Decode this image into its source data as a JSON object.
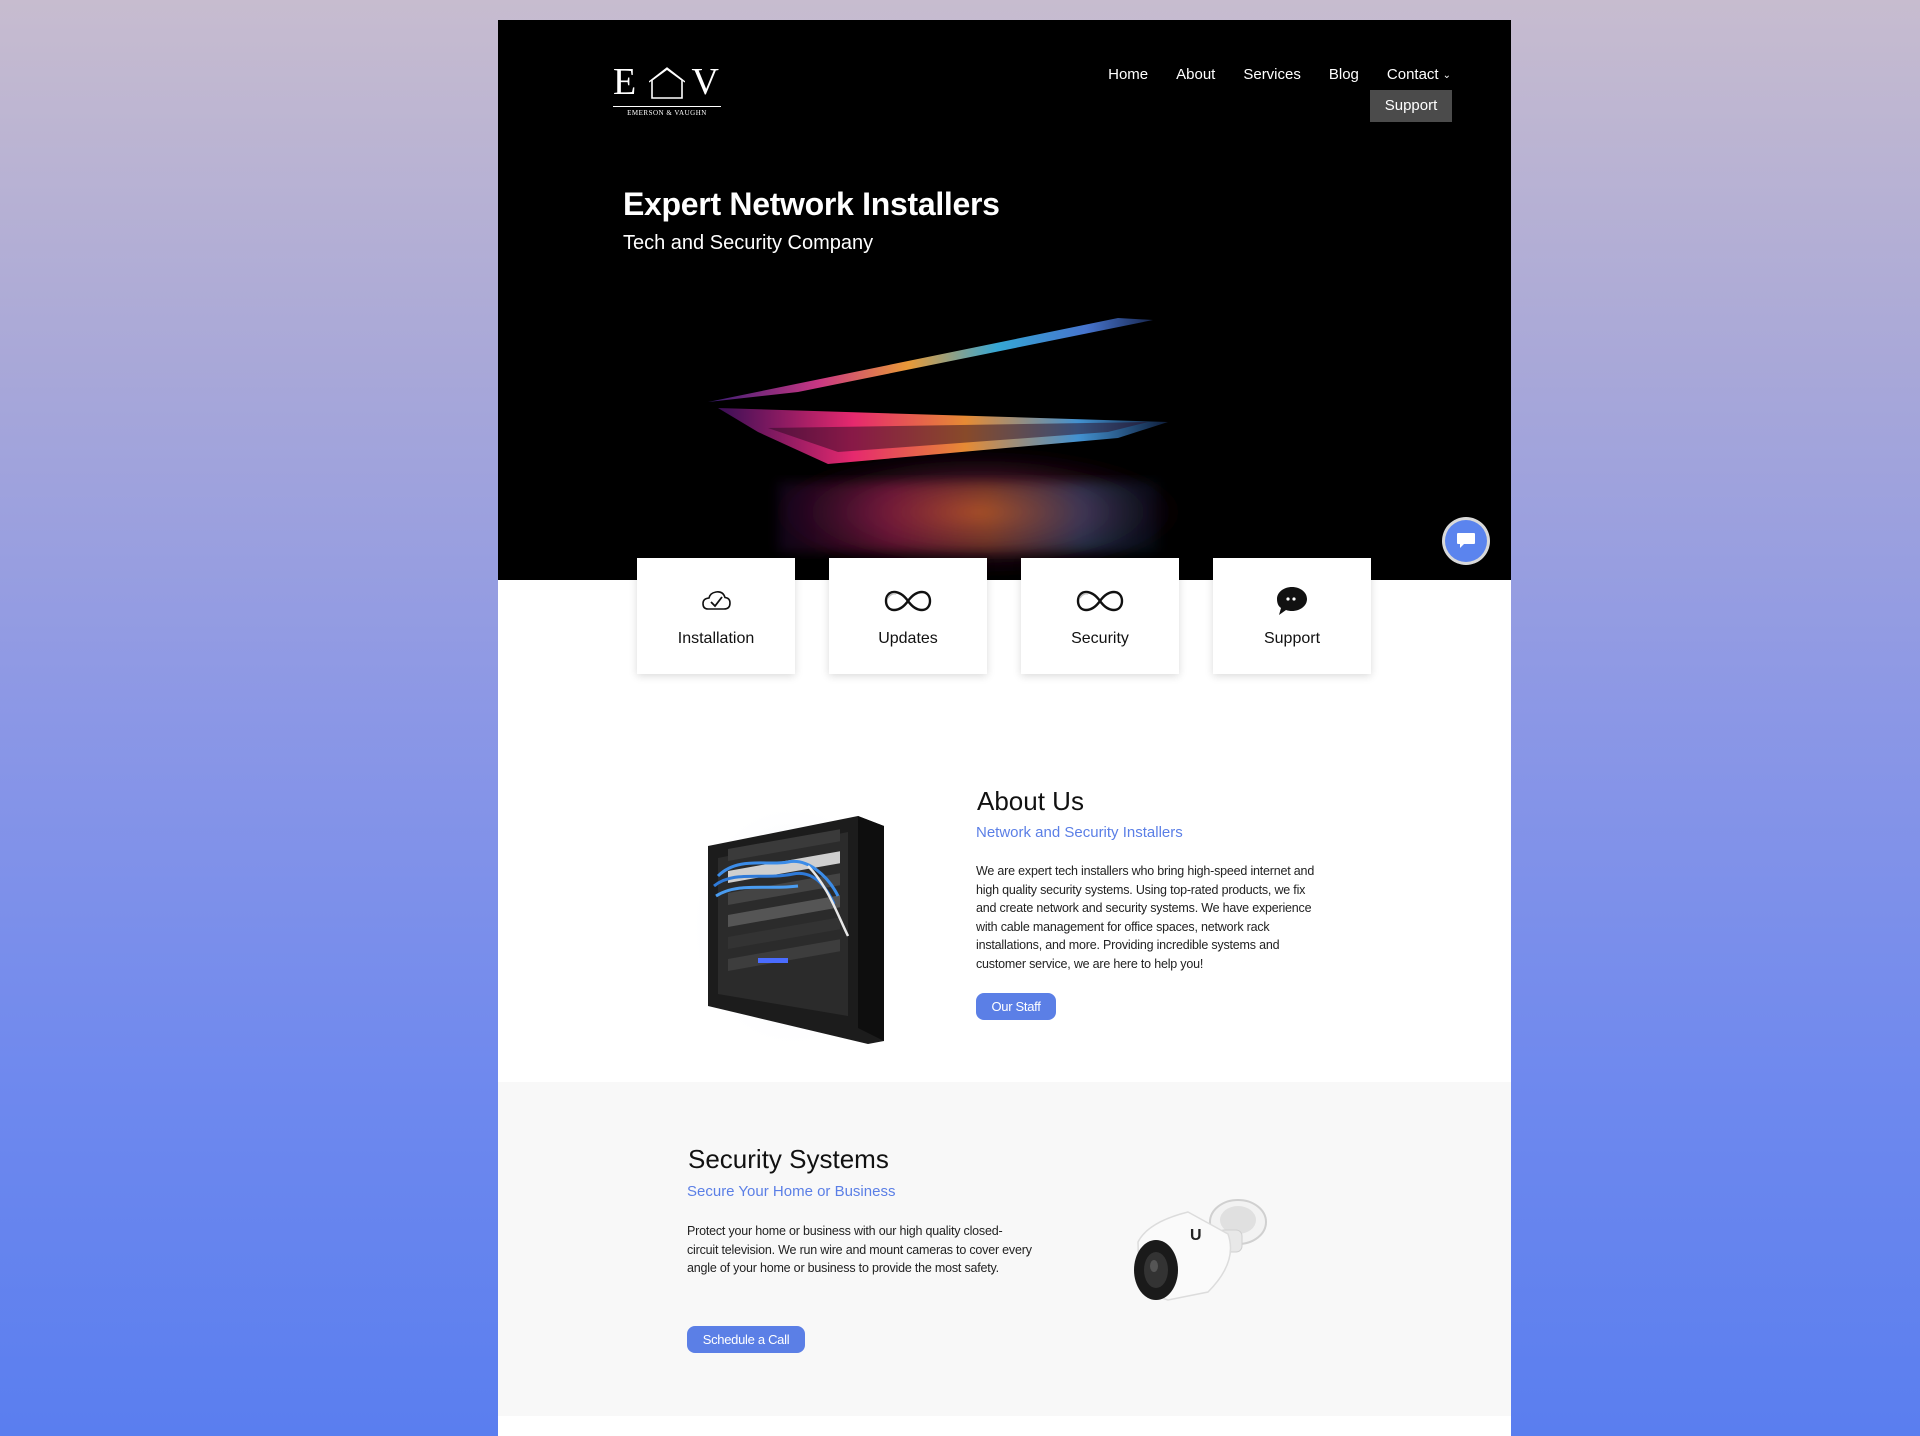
{
  "brand": {
    "logo_letters": "E V",
    "logo_subtitle": "EMERSON & VAUGHN"
  },
  "nav": {
    "items": [
      {
        "label": "Home"
      },
      {
        "label": "About"
      },
      {
        "label": "Services"
      },
      {
        "label": "Blog"
      },
      {
        "label": "Contact"
      }
    ],
    "support_label": "Support"
  },
  "hero": {
    "title": "Expert Network Installers",
    "subtitle": "Tech and Security Company"
  },
  "features": [
    {
      "label": "Installation",
      "icon": "cloud-check-icon"
    },
    {
      "label": "Updates",
      "icon": "infinity-icon"
    },
    {
      "label": "Security",
      "icon": "infinity-icon"
    },
    {
      "label": "Support",
      "icon": "chat-bubble-icon"
    }
  ],
  "about": {
    "title": "About Us",
    "subtitle": "Network and Security Installers",
    "body": "We are expert tech installers who bring high-speed internet and high quality security systems. Using top-rated products, we fix and create network and security systems. We have experience with cable management for office spaces, network rack installations, and more. Providing incredible systems and customer service, we are here to help you!",
    "button_label": "Our Staff"
  },
  "security": {
    "title": "Security Systems",
    "subtitle": "Secure Your Home or Business",
    "body": "Protect your home or business with our high quality closed-circuit television. We run wire and mount cameras to cover every angle of your home or business to provide the most safety.",
    "button_label": "Schedule a Call"
  },
  "colors": {
    "accent": "#5b7fe6",
    "hero_bg": "#000000",
    "support_button": "#4b4b4b",
    "section_bg": "#f8f8f8"
  }
}
